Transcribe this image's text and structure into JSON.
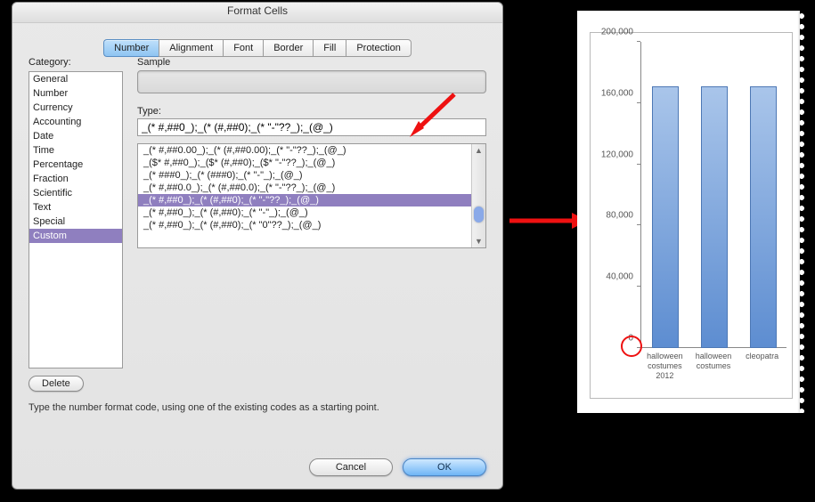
{
  "dialog": {
    "title": "Format Cells",
    "tabs": [
      "Number",
      "Alignment",
      "Font",
      "Border",
      "Fill",
      "Protection"
    ],
    "active_tab_index": 0,
    "category_label": "Category:",
    "categories": [
      "General",
      "Number",
      "Currency",
      "Accounting",
      "Date",
      "Time",
      "Percentage",
      "Fraction",
      "Scientific",
      "Text",
      "Special",
      "Custom"
    ],
    "selected_category_index": 11,
    "sample_label": "Sample",
    "type_label": "Type:",
    "type_value": "_(* #,##0_);_(* (#,##0);_(* \"-\"??_);_(@_)",
    "format_codes": [
      "_(* #,##0.00_);_(* (#,##0.00);_(* \"-\"??_);_(@_)",
      "_($* #,##0_);_($* (#,##0);_($* \"-\"??_);_(@_)",
      "_(* ###0_);_(* (###0);_(* \"-\"_);_(@_)",
      "_(* #,##0.0_);_(* (#,##0.0);_(* \"-\"??_);_(@_)",
      "_(* #,##0_);_(* (#,##0);_(* \"-\"??_);_(@_)",
      "_(* #,##0_);_(* (#,##0);_(* \"-\"_);_(@_)",
      "_(* #,##0_);_(* (#,##0);_(* \"0\"??_);_(@_)"
    ],
    "selected_code_index": 4,
    "delete_label": "Delete",
    "hint": "Type the number format code, using one of the existing codes as a starting point.",
    "cancel_label": "Cancel",
    "ok_label": "OK"
  },
  "chart_data": {
    "type": "bar",
    "categories": [
      "halloween costumes 2012",
      "halloween costumes",
      "cleopatra"
    ],
    "values": [
      170000,
      170000,
      170000
    ],
    "title": "",
    "xlabel": "",
    "ylabel": "",
    "ylim": [
      0,
      200000
    ],
    "yticks": [
      0,
      40000,
      80000,
      120000,
      160000,
      200000
    ],
    "ytick_labels": [
      "0",
      "40,000",
      "80,000",
      "120,000",
      "160,000",
      "200,000"
    ]
  }
}
